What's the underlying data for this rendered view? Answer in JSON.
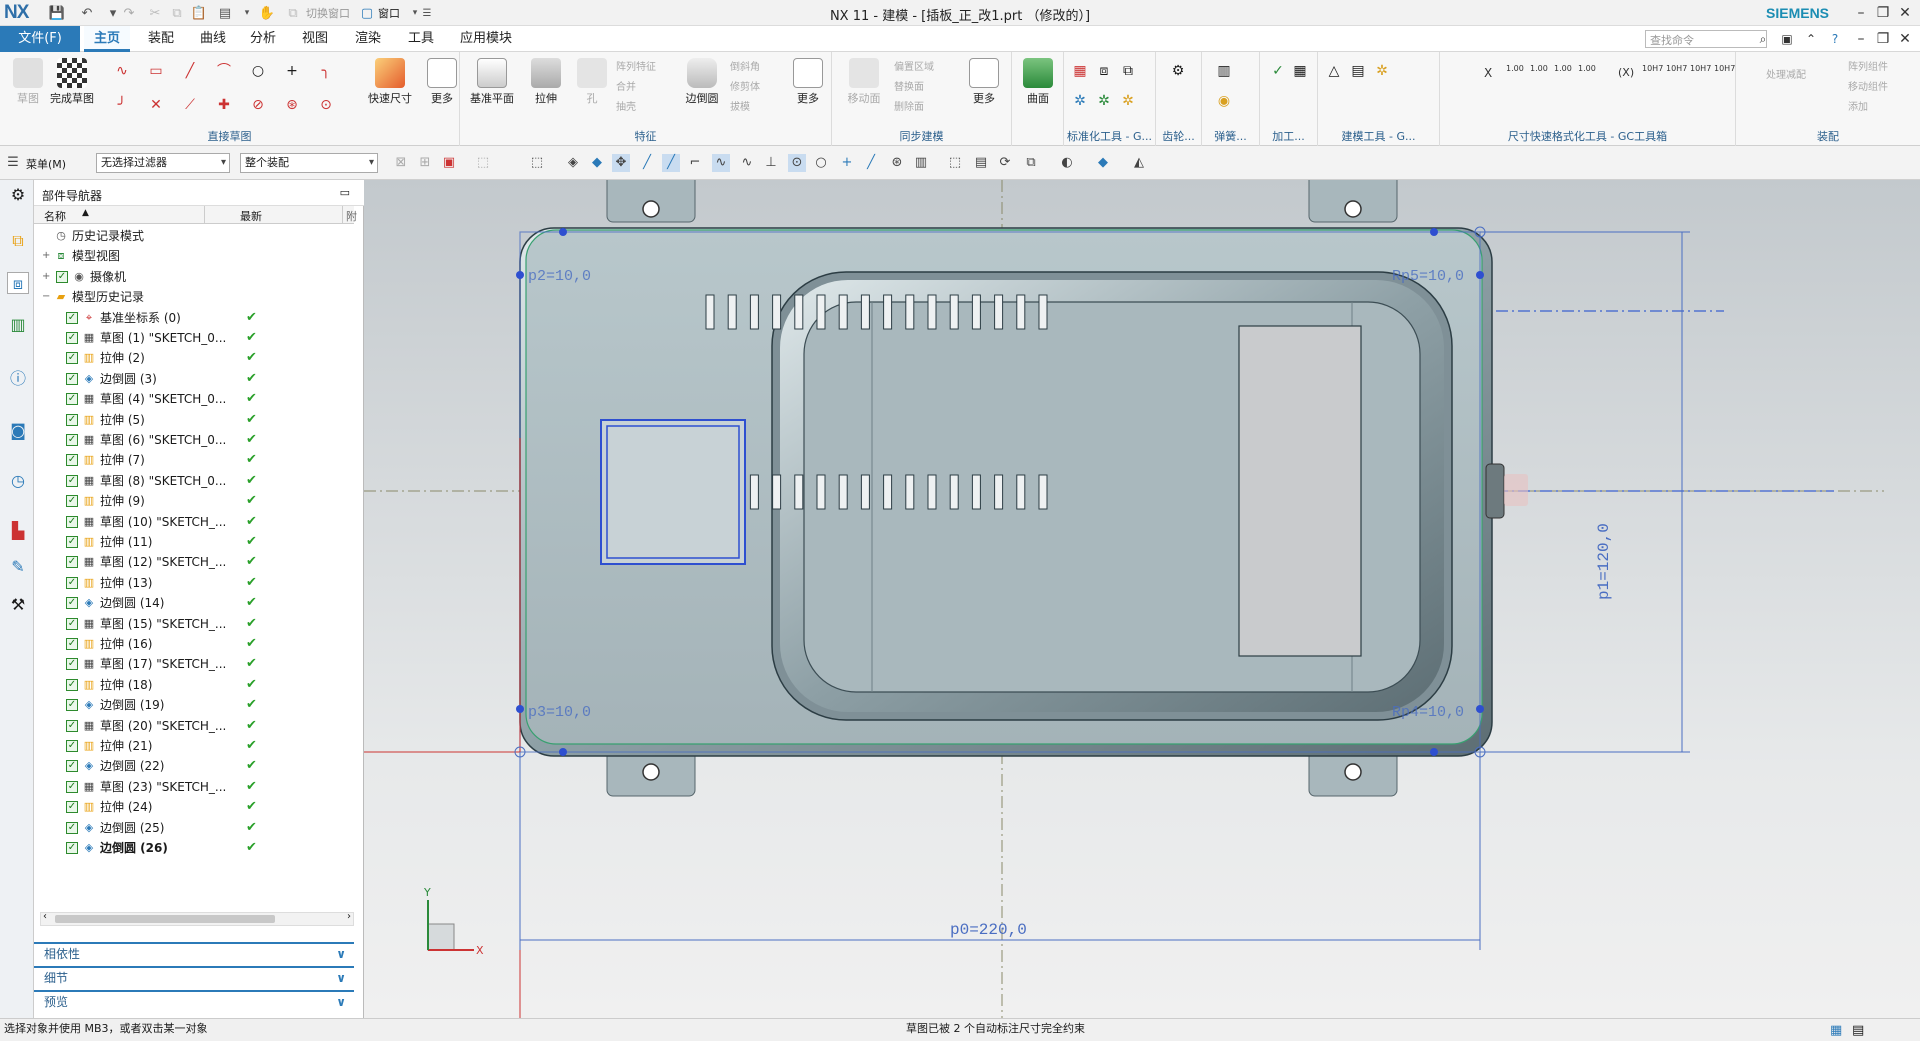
{
  "window": {
    "logo": "NX",
    "title": "NX 11 - 建模 - [插板_正_改1.prt （修改的）]",
    "brand": "SIEMENS",
    "switch_window": "切换窗口",
    "window_menu": "窗口"
  },
  "menubar": {
    "file": "文件(F)",
    "tabs": [
      "主页",
      "装配",
      "曲线",
      "分析",
      "视图",
      "渲染",
      "工具",
      "应用模块"
    ],
    "search_placeholder": "查找命令"
  },
  "ribbon": {
    "sketch": {
      "btn1": "草图",
      "btn2": "完成草图",
      "label": "直接草图"
    },
    "smart_dim": "快速尺寸",
    "more1": "更多",
    "feature": {
      "datum_plane": "基准平面",
      "extrude": "拉伸",
      "hole": "孔",
      "edge_blend": "边倒圆",
      "more": "更多",
      "label": "特征",
      "small": [
        "阵列特征",
        "合并",
        "抽壳",
        "倒斜角",
        "修剪体",
        "拔模"
      ]
    },
    "sync": {
      "move_face": "移动面",
      "label": "同步建模",
      "small": [
        "偏置区域",
        "替换面",
        "删除面"
      ]
    },
    "more2": "更多",
    "surface": "曲面",
    "labels": [
      "标准化工具 - G...",
      "齿轮...",
      "弹簧...",
      "加工...",
      "建模工具 - G...",
      "尺寸快速格式化工具 - GC工具箱",
      "装配"
    ],
    "dim_tags": [
      "X",
      "1.00",
      "1.00",
      "1.00",
      "1.00",
      "(X)",
      "10H7",
      "10H7",
      "10H7",
      "10H7"
    ],
    "assembly": {
      "btn": "处理减配",
      "small": [
        "阵列组件",
        "移动组件",
        "添加"
      ]
    }
  },
  "toolbar2": {
    "menu": "菜单(M)",
    "filter": "无选择过滤器",
    "scope": "整个装配"
  },
  "navigator": {
    "title": "部件导航器",
    "col_name": "名称",
    "col_latest": "最新",
    "col_extra": "附",
    "rows": [
      {
        "name": "历史记录模式",
        "level": 1,
        "icon": "clock",
        "check": false,
        "ok": false
      },
      {
        "name": "模型视图",
        "level": 1,
        "icon": "views",
        "check": false,
        "ok": false,
        "exp": "+"
      },
      {
        "name": "摄像机",
        "level": 1,
        "icon": "camera",
        "check": true,
        "ok": false,
        "exp": "+"
      },
      {
        "name": "模型历史记录",
        "level": 1,
        "icon": "folder",
        "check": false,
        "ok": false,
        "exp": "−"
      },
      {
        "name": "基准坐标系 (0)",
        "level": 2,
        "icon": "csys",
        "check": true,
        "ok": true
      },
      {
        "name": "草图 (1) \"SKETCH_0...",
        "level": 2,
        "icon": "sketch",
        "check": true,
        "ok": true
      },
      {
        "name": "拉伸 (2)",
        "level": 2,
        "icon": "extrude",
        "check": true,
        "ok": true
      },
      {
        "name": "边倒圆 (3)",
        "level": 2,
        "icon": "blend",
        "check": true,
        "ok": true
      },
      {
        "name": "草图 (4) \"SKETCH_0...",
        "level": 2,
        "icon": "sketch",
        "check": true,
        "ok": true
      },
      {
        "name": "拉伸 (5)",
        "level": 2,
        "icon": "extrude",
        "check": true,
        "ok": true
      },
      {
        "name": "草图 (6) \"SKETCH_0...",
        "level": 2,
        "icon": "sketch",
        "check": true,
        "ok": true
      },
      {
        "name": "拉伸 (7)",
        "level": 2,
        "icon": "extrude",
        "check": true,
        "ok": true
      },
      {
        "name": "草图 (8) \"SKETCH_0...",
        "level": 2,
        "icon": "sketch",
        "check": true,
        "ok": true
      },
      {
        "name": "拉伸 (9)",
        "level": 2,
        "icon": "extrude",
        "check": true,
        "ok": true
      },
      {
        "name": "草图 (10) \"SKETCH_...",
        "level": 2,
        "icon": "sketch",
        "check": true,
        "ok": true
      },
      {
        "name": "拉伸 (11)",
        "level": 2,
        "icon": "extrude",
        "check": true,
        "ok": true
      },
      {
        "name": "草图 (12) \"SKETCH_...",
        "level": 2,
        "icon": "sketch",
        "check": true,
        "ok": true
      },
      {
        "name": "拉伸 (13)",
        "level": 2,
        "icon": "extrude",
        "check": true,
        "ok": true
      },
      {
        "name": "边倒圆 (14)",
        "level": 2,
        "icon": "blend",
        "check": true,
        "ok": true
      },
      {
        "name": "草图 (15) \"SKETCH_...",
        "level": 2,
        "icon": "sketch",
        "check": true,
        "ok": true
      },
      {
        "name": "拉伸 (16)",
        "level": 2,
        "icon": "extrude",
        "check": true,
        "ok": true
      },
      {
        "name": "草图 (17) \"SKETCH_...",
        "level": 2,
        "icon": "sketch",
        "check": true,
        "ok": true
      },
      {
        "name": "拉伸 (18)",
        "level": 2,
        "icon": "extrude",
        "check": true,
        "ok": true
      },
      {
        "name": "边倒圆 (19)",
        "level": 2,
        "icon": "blend",
        "check": true,
        "ok": true
      },
      {
        "name": "草图 (20) \"SKETCH_...",
        "level": 2,
        "icon": "sketch",
        "check": true,
        "ok": true
      },
      {
        "name": "拉伸 (21)",
        "level": 2,
        "icon": "extrude",
        "check": true,
        "ok": true
      },
      {
        "name": "边倒圆 (22)",
        "level": 2,
        "icon": "blend",
        "check": true,
        "ok": true
      },
      {
        "name": "草图 (23) \"SKETCH_...",
        "level": 2,
        "icon": "sketch",
        "check": true,
        "ok": true
      },
      {
        "name": "拉伸 (24)",
        "level": 2,
        "icon": "extrude",
        "check": true,
        "ok": true
      },
      {
        "name": "边倒圆 (25)",
        "level": 2,
        "icon": "blend",
        "check": true,
        "ok": true
      },
      {
        "name": "边倒圆 (26)",
        "level": 2,
        "icon": "blend",
        "check": true,
        "ok": true,
        "bold": true
      }
    ],
    "panels": [
      "相依性",
      "细节",
      "预览"
    ]
  },
  "viewport": {
    "dim_top_left": "p2=10,0",
    "dim_top_right": "Rp5=10,0",
    "dim_bottom_left": "p3=10,0",
    "dim_bottom_right": "Rp4=10,0",
    "dim_height": "p1=120,0",
    "dim_width": "p0=220,0",
    "axis_x": "X",
    "axis_y": "Y"
  },
  "status": {
    "left": "选择对象并使用 MB3，或者双击某一对象",
    "center": "草图已被 2 个自动标注尺寸完全约束"
  },
  "colors": {
    "accent": "#2b7ab8",
    "part_body": "#a9b8bd",
    "dim_blue": "#4a6ec2",
    "sketch_blue": "#2e4fd0",
    "ok_green": "#2aa02a"
  }
}
